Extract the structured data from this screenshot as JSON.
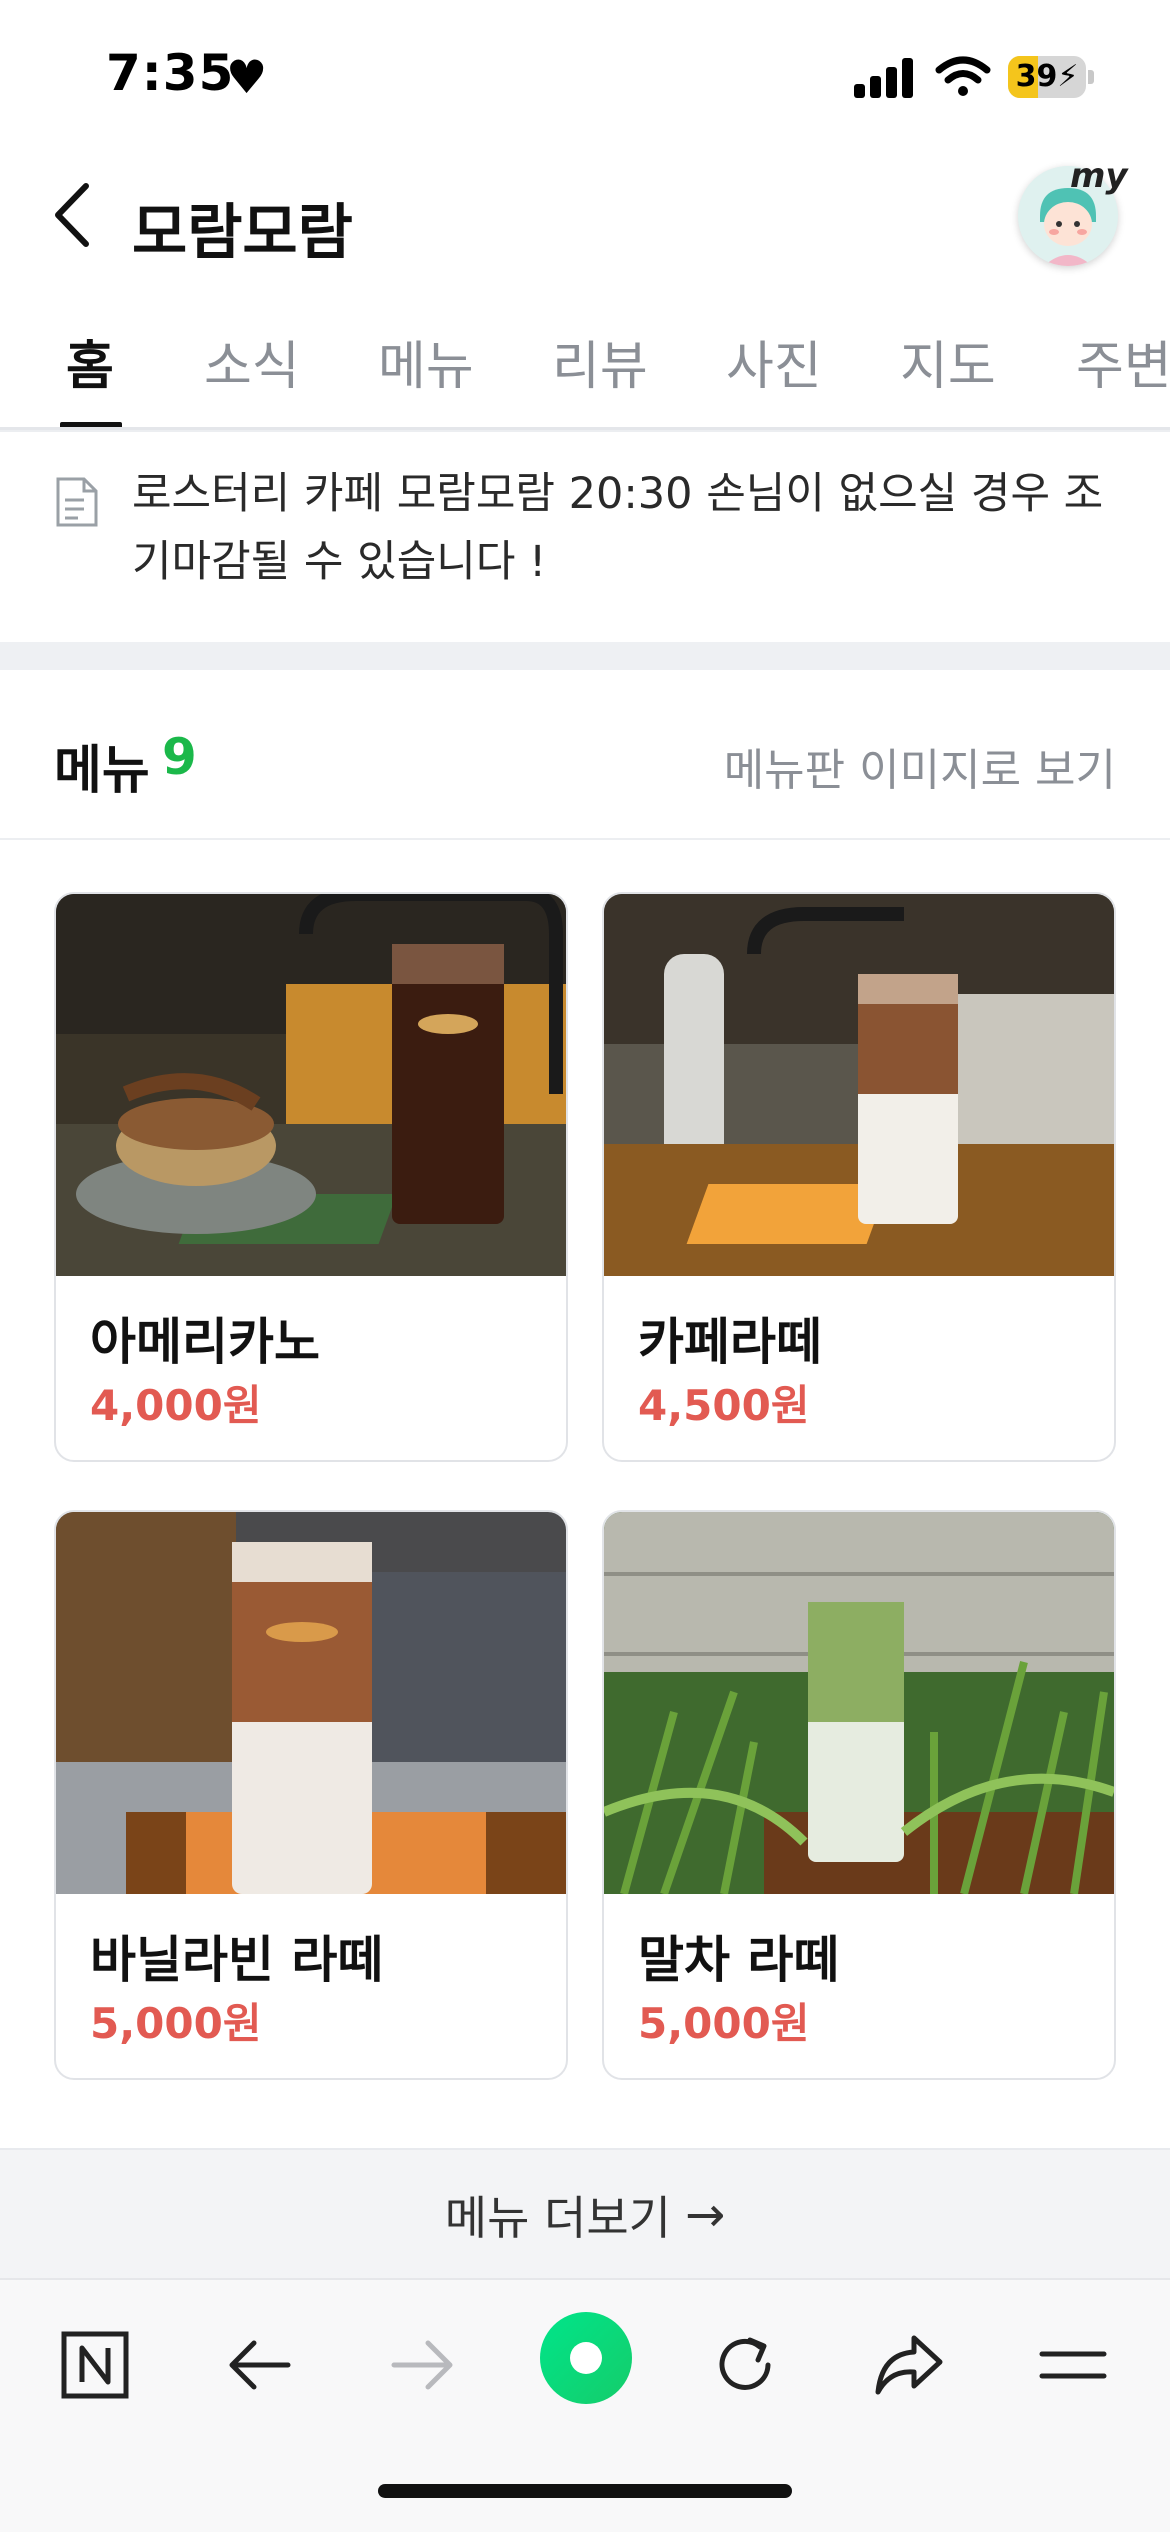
{
  "status_bar": {
    "time": "7:35",
    "battery_level": 39,
    "battery_label": "39"
  },
  "header": {
    "title": "모람모람",
    "my_label": "my"
  },
  "tabs": [
    {
      "label": "홈",
      "active": true
    },
    {
      "label": "소식",
      "active": false
    },
    {
      "label": "메뉴",
      "active": false
    },
    {
      "label": "리뷰",
      "active": false
    },
    {
      "label": "사진",
      "active": false
    },
    {
      "label": "지도",
      "active": false
    },
    {
      "label": "주변",
      "active": false
    }
  ],
  "notice": {
    "text": "로스터리 카페 모람모람 20:30 손님이 없으실 경우 조기마감될 수 있습니다 !"
  },
  "menu": {
    "title": "메뉴",
    "count": "9",
    "board_link": "메뉴판 이미지로 보기",
    "items": [
      {
        "name": "아메리카노",
        "price": "4,000원"
      },
      {
        "name": "카페라떼",
        "price": "4,500원"
      },
      {
        "name": "바닐라빈 라떼",
        "price": "5,000원"
      },
      {
        "name": "말차 라떼",
        "price": "5,000원"
      }
    ],
    "more_label": "메뉴 더보기",
    "more_arrow": "→"
  },
  "toolbar": {
    "icons": [
      "naver-n-icon",
      "back-arrow-icon",
      "forward-arrow-icon",
      "green-dot-icon",
      "refresh-icon",
      "share-icon",
      "menu-icon"
    ]
  },
  "colors": {
    "accent_green": "#1bb84a",
    "price_red": "#e25a52",
    "green_button": "#12d97a"
  }
}
